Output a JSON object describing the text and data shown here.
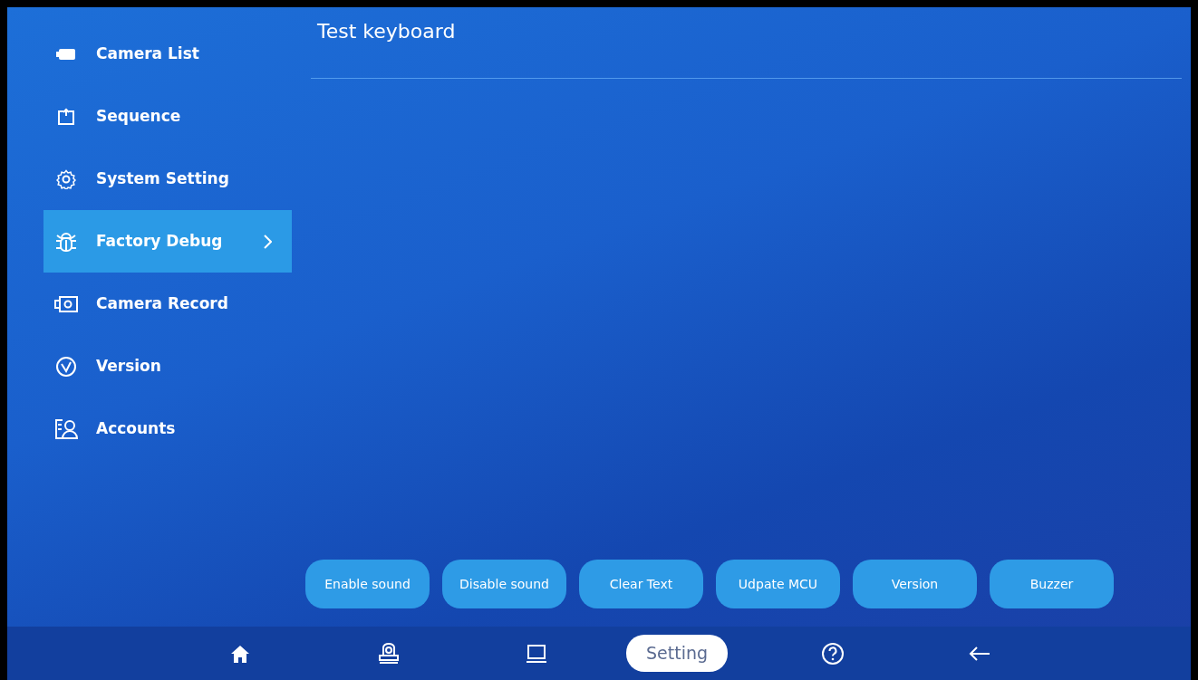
{
  "sidebar": {
    "items": [
      {
        "kind": "camera",
        "label": "Camera List",
        "selected": false
      },
      {
        "kind": "sequence",
        "label": "Sequence",
        "selected": false
      },
      {
        "kind": "gear",
        "label": "System Setting",
        "selected": false
      },
      {
        "kind": "bug",
        "label": "Factory Debug",
        "selected": true
      },
      {
        "kind": "record",
        "label": "Camera Record",
        "selected": false
      },
      {
        "kind": "version",
        "label": "Version",
        "selected": false
      },
      {
        "kind": "accounts",
        "label": "Accounts",
        "selected": false
      }
    ]
  },
  "content": {
    "title": "Test keyboard"
  },
  "buttons": [
    "Enable sound",
    "Disable sound",
    "Clear Text",
    "Udpate MCU",
    "Version",
    "Buzzer"
  ],
  "bottom_bar": {
    "items": [
      {
        "kind": "home",
        "selected": false
      },
      {
        "kind": "ptz",
        "selected": false
      },
      {
        "kind": "screen",
        "selected": false
      },
      {
        "kind": "text",
        "label": "Setting",
        "selected": true
      },
      {
        "kind": "help",
        "selected": false
      },
      {
        "kind": "back",
        "selected": false
      }
    ]
  }
}
